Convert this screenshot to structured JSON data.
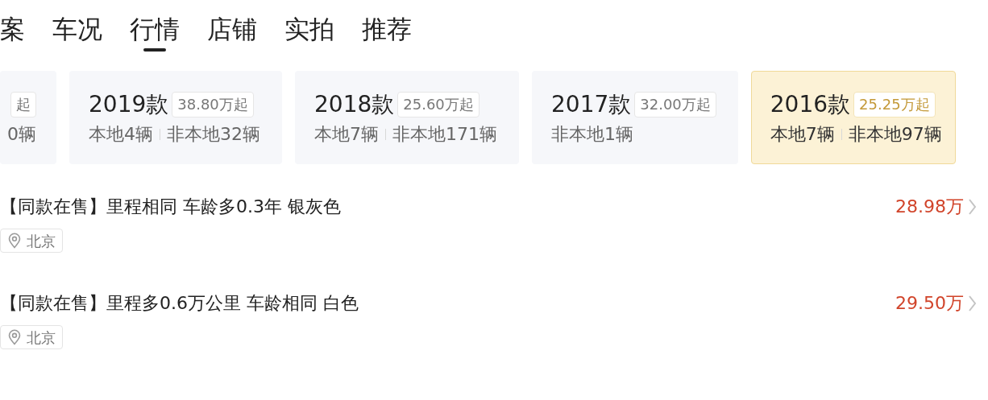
{
  "tabs": [
    {
      "label": "案",
      "selected": false
    },
    {
      "label": "车况",
      "selected": false
    },
    {
      "label": "行情",
      "selected": true
    },
    {
      "label": "店铺",
      "selected": false
    },
    {
      "label": "实拍",
      "selected": false
    },
    {
      "label": "推荐",
      "selected": false
    }
  ],
  "model_years": [
    {
      "price": "起",
      "counts": [
        "0辆"
      ],
      "selected": false
    },
    {
      "year": "2019款",
      "price": "38.80万起",
      "counts": [
        "本地4辆",
        "非本地32辆"
      ],
      "selected": false
    },
    {
      "year": "2018款",
      "price": "25.60万起",
      "counts": [
        "本地7辆",
        "非本地171辆"
      ],
      "selected": false
    },
    {
      "year": "2017款",
      "price": "32.00万起",
      "counts": [
        "非本地1辆"
      ],
      "selected": false
    },
    {
      "year": "2016款",
      "price": "25.25万起",
      "counts": [
        "本地7辆",
        "非本地97辆"
      ],
      "selected": true
    }
  ],
  "listings": [
    {
      "title": "【同款在售】里程相同 车龄多0.3年 银灰色",
      "location": "北京",
      "price": "28.98万"
    },
    {
      "title": "【同款在售】里程多0.6万公里 车龄相同 白色",
      "location": "北京",
      "price": "29.50万"
    }
  ]
}
